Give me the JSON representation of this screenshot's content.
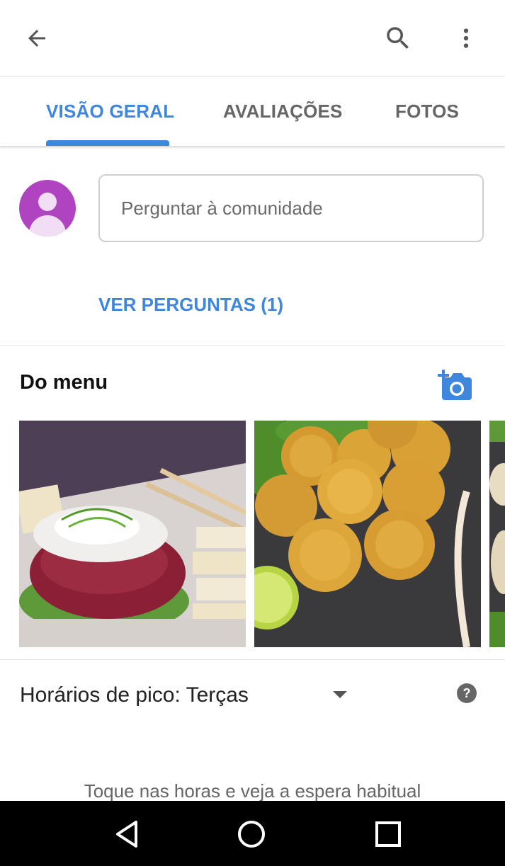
{
  "topbar": {
    "back_icon": "arrow-back-icon",
    "search_icon": "search-icon",
    "more_icon": "more-vert-icon"
  },
  "tabs": [
    {
      "label": "VISÃO GERAL",
      "active": true
    },
    {
      "label": "AVALIAÇÕES",
      "active": false
    },
    {
      "label": "FOTOS",
      "active": false
    }
  ],
  "qa": {
    "input_placeholder": "Perguntar à comunidade",
    "see_questions": "VER PERGUNTAS (1)"
  },
  "menu": {
    "title": "Do menu",
    "add_photo_icon": "add-a-photo-icon",
    "photos": [
      {
        "name": "tuna-tartare-photo"
      },
      {
        "name": "croquettes-photo"
      },
      {
        "name": "partial-dish-photo"
      }
    ]
  },
  "peak": {
    "label": "Horários de pico: Terças",
    "dropdown_icon": "arrow-drop-down-icon",
    "help_icon": "help-icon",
    "hint": "Toque nas horas e veja a espera habitual"
  },
  "navbar": {
    "back_icon": "nav-back-icon",
    "home_icon": "nav-home-icon",
    "recent_icon": "nav-recents-icon"
  },
  "colors": {
    "accent": "#3f86dd",
    "avatar": "#b044c0",
    "navbar": "#000000"
  }
}
